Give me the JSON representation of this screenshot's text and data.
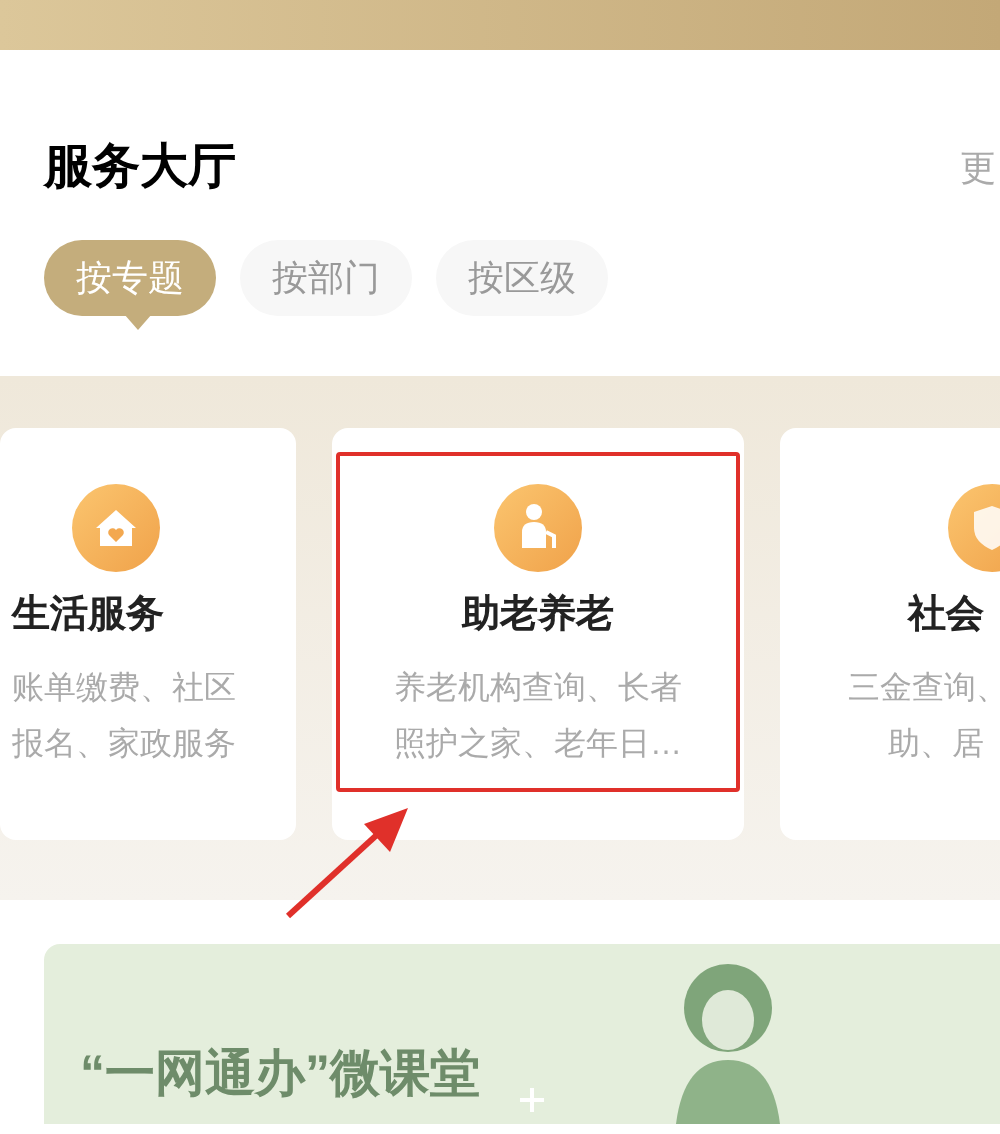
{
  "section_title": "服务大厅",
  "more_link": "更",
  "tabs": [
    {
      "label": "按专题",
      "selected": true
    },
    {
      "label": "按部门",
      "selected": false
    },
    {
      "label": "按区级",
      "selected": false
    }
  ],
  "cards": [
    {
      "kind": "home",
      "title": "生活服务",
      "lines": [
        "账单缴费、社区",
        "报名、家政服务"
      ],
      "highlighted": false
    },
    {
      "kind": "elder",
      "title": "助老养老",
      "lines": [
        "养老机构查询、长者",
        "照护之家、老年日…"
      ],
      "highlighted": true
    },
    {
      "kind": "shield",
      "title": "社会",
      "lines": [
        "三金查询、",
        "助、居"
      ],
      "highlighted": false
    }
  ],
  "banner": {
    "title": "“一网通办”微课堂"
  }
}
